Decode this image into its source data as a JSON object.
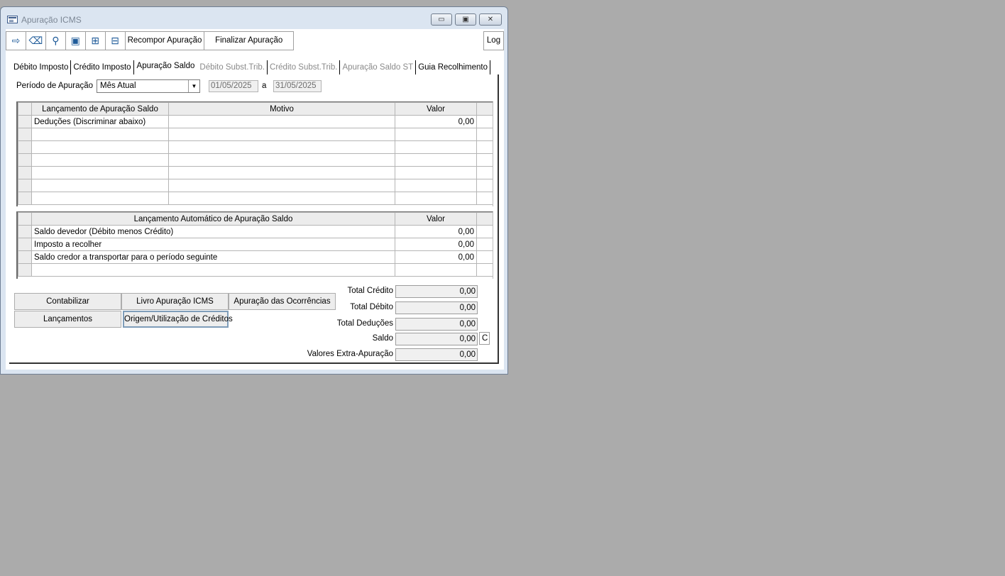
{
  "window": {
    "title": "Apuração ICMS",
    "minimize_glyph": "▭",
    "maximize_glyph": "▣",
    "close_glyph": "✕"
  },
  "toolbar": {
    "icons": [
      "exit-icon",
      "eraser-icon",
      "search-icon",
      "save-icon",
      "add-row-icon",
      "remove-row-icon"
    ],
    "icon_glyphs": [
      "⇨",
      "⌫",
      "⚲",
      "▣",
      "⊞",
      "⊟"
    ],
    "recompor_label": "Recompor Apuração",
    "finalizar_label": "Finalizar Apuração",
    "log_label": "Log"
  },
  "tabs": [
    {
      "label": "Débito Imposto",
      "state": "enabled"
    },
    {
      "label": "Crédito Imposto",
      "state": "enabled"
    },
    {
      "label": "Apuração Saldo",
      "state": "active"
    },
    {
      "label": "Débito Subst.Trib.",
      "state": "disabled"
    },
    {
      "label": "Crédito Subst.Trib.",
      "state": "disabled"
    },
    {
      "label": "Apuração Saldo ST",
      "state": "disabled"
    },
    {
      "label": "Guia Recolhimento",
      "state": "enabled"
    }
  ],
  "period": {
    "label": "Período de  Apuração",
    "selected": "Mês Atual",
    "from": "01/05/2025",
    "separator": "a",
    "to": "31/05/2025"
  },
  "grid1": {
    "headers": [
      "Lançamento de Apuração Saldo",
      "Motivo",
      "Valor"
    ],
    "rows": [
      [
        "Deduções (Discriminar abaixo)",
        "",
        "0,00"
      ],
      [
        "",
        "",
        ""
      ],
      [
        "",
        "",
        ""
      ],
      [
        "",
        "",
        ""
      ],
      [
        "",
        "",
        ""
      ],
      [
        "",
        "",
        ""
      ],
      [
        "",
        "",
        ""
      ]
    ]
  },
  "grid2": {
    "headers": [
      "Lançamento Automático de Apuração Saldo",
      "Valor"
    ],
    "rows": [
      [
        "Saldo devedor (Débito menos Crédito)",
        "0,00"
      ],
      [
        "Imposto a recolher",
        "0,00"
      ],
      [
        "Saldo credor a transportar para o período seguinte",
        "0,00"
      ],
      [
        "",
        ""
      ]
    ]
  },
  "buttons": {
    "contabilizar": "Contabilizar",
    "livro": "Livro Apuração ICMS",
    "ocorrencias": "Apuração das Ocorrências",
    "lancamentos": "Lançamentos",
    "origem": "Origem/Utilização de Créditos"
  },
  "totals": {
    "credito_label": "Total Crédito",
    "credito": "0,00",
    "debito_label": "Total Débito",
    "debito": "0,00",
    "deducoes_label": "Total Deduções",
    "deducoes": "0,00",
    "saldo_label": "Saldo",
    "saldo": "0,00",
    "saldo_type": "C",
    "extra_label": "Valores Extra-Apuração",
    "extra": "0,00"
  }
}
